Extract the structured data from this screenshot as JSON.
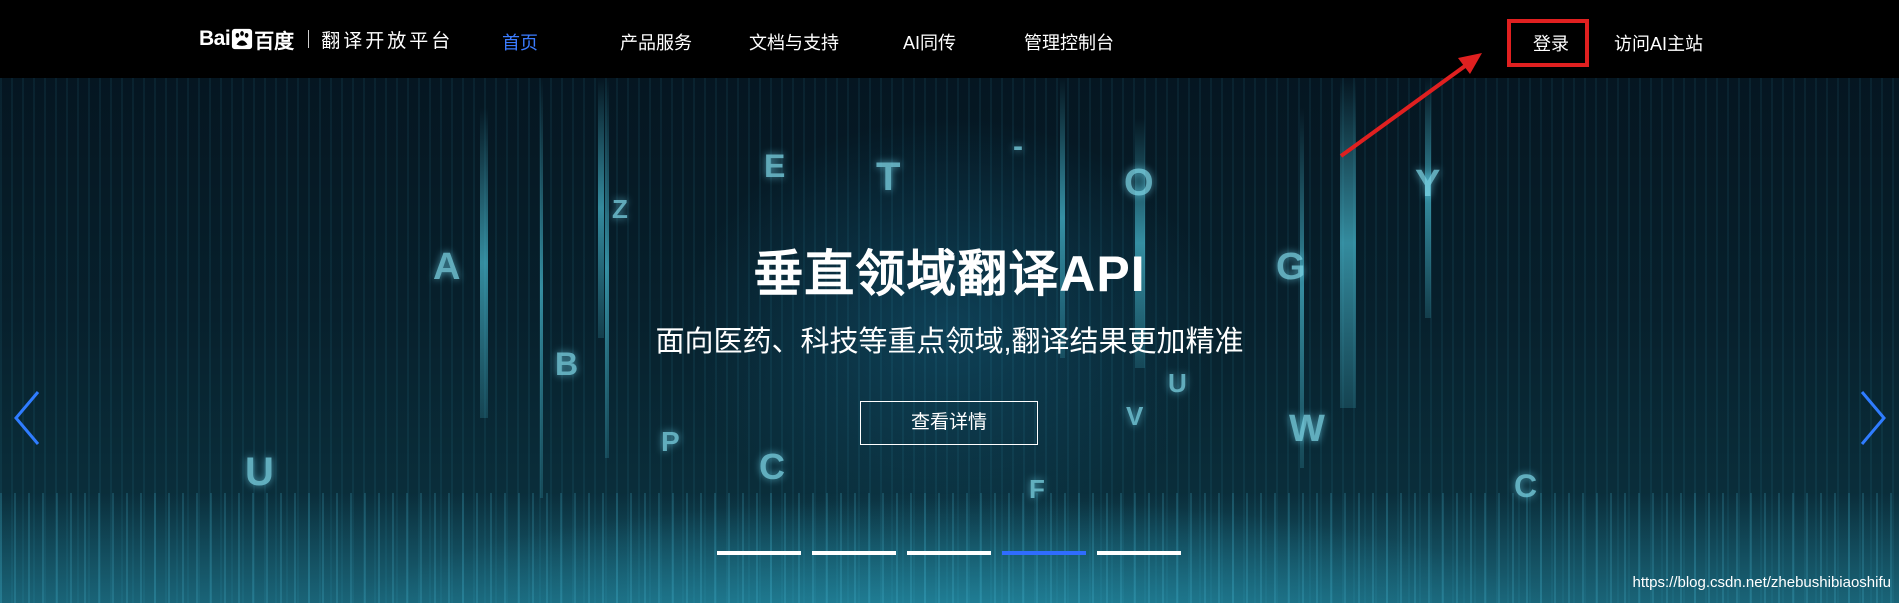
{
  "logo": {
    "bai": "Bai",
    "du": "百度",
    "name": "翻译开放平台"
  },
  "nav": {
    "items": [
      {
        "label": "首页",
        "active": true
      },
      {
        "label": "产品服务"
      },
      {
        "label": "文档与支持"
      },
      {
        "label": "AI同传"
      },
      {
        "label": "管理控制台"
      }
    ],
    "login_label": "登录",
    "visit_label": "访问AI主站"
  },
  "hero": {
    "title": "垂直领域翻译API",
    "subtitle": "面向医药、科技等重点领域,翻译结果更加精准",
    "button_label": "查看详情",
    "carousel_active_index": 3,
    "carousel_count": 5,
    "floating_letters": [
      "A",
      "Z",
      "E",
      "T",
      "-",
      "O",
      "Y",
      "G",
      "B",
      "U",
      "V",
      "W",
      "P",
      "C",
      "U",
      "F",
      "C"
    ]
  },
  "watermark": "https://blog.csdn.net/zhebushibiaoshifu",
  "colors": {
    "accent": "#3b7cff",
    "highlight_box": "#e02020",
    "nav_bg": "#000000"
  }
}
